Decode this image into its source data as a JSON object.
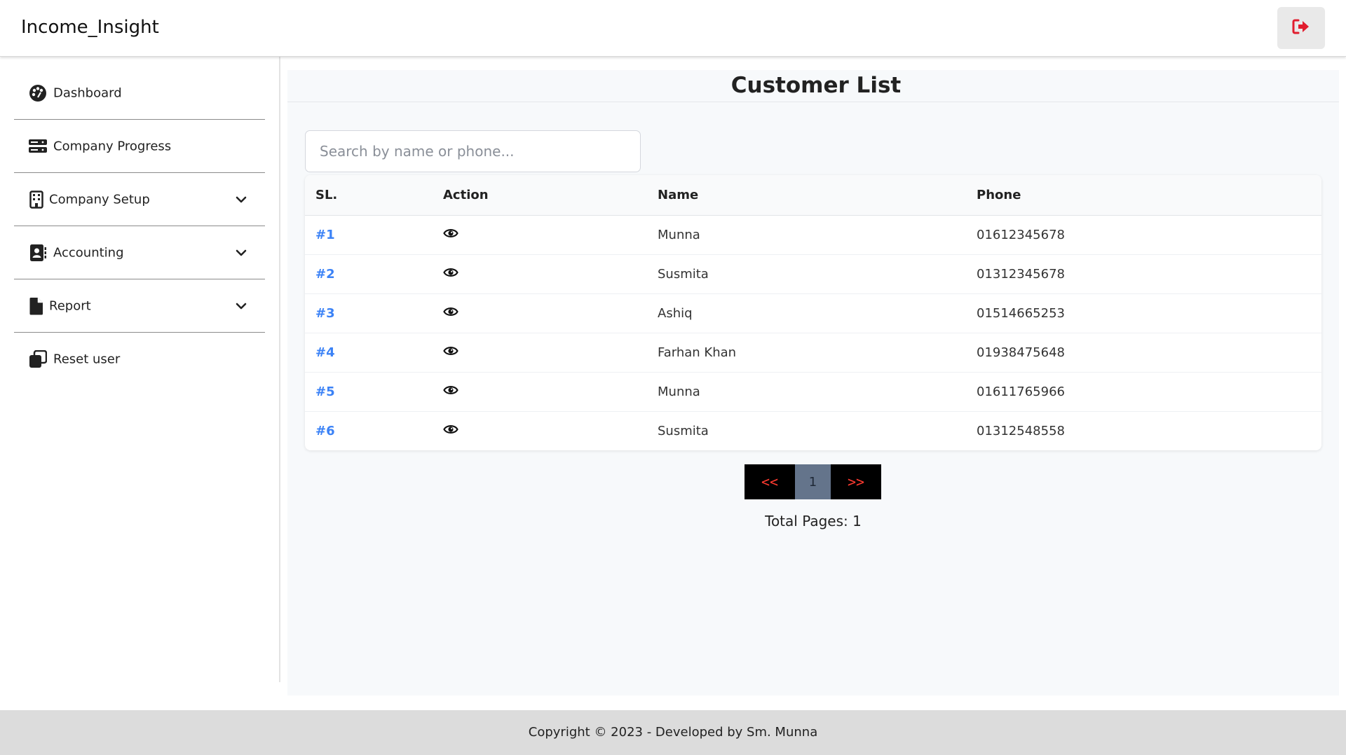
{
  "app": {
    "brand": "Income_Insight"
  },
  "header": {
    "logout_icon": "sign-out-icon",
    "accent": "#e11d2e"
  },
  "sidebar": {
    "items": [
      {
        "label": "Dashboard",
        "icon": "palette-icon",
        "expandable": false
      },
      {
        "label": "Company Progress",
        "icon": "server-icon",
        "expandable": false
      },
      {
        "label": "Company Setup",
        "icon": "building-icon",
        "expandable": true
      },
      {
        "label": "Accounting",
        "icon": "contact-book-icon",
        "expandable": true
      },
      {
        "label": "Report",
        "icon": "file-icon",
        "expandable": true
      },
      {
        "label": "Reset user",
        "icon": "copy-icon",
        "expandable": false
      }
    ]
  },
  "main": {
    "title": "Customer List",
    "search": {
      "placeholder": "Search by name or phone...",
      "value": ""
    },
    "table": {
      "columns": [
        "SL.",
        "Action",
        "Name",
        "Phone"
      ],
      "rows": [
        {
          "sl": "#1",
          "name": "Munna",
          "phone": "01612345678"
        },
        {
          "sl": "#2",
          "name": "Susmita",
          "phone": "01312345678"
        },
        {
          "sl": "#3",
          "name": "Ashiq",
          "phone": "01514665253"
        },
        {
          "sl": "#4",
          "name": "Farhan Khan",
          "phone": "01938475648"
        },
        {
          "sl": "#5",
          "name": "Munna",
          "phone": "01611765966"
        },
        {
          "sl": "#6",
          "name": "Susmita",
          "phone": "01312548558"
        }
      ]
    },
    "pagination": {
      "prev_label": "<<",
      "current_page": "1",
      "next_label": ">>",
      "total_text": "Total Pages: 1"
    }
  },
  "footer": {
    "text": "Copyright © 2023 - Developed by Sm. Munna"
  }
}
